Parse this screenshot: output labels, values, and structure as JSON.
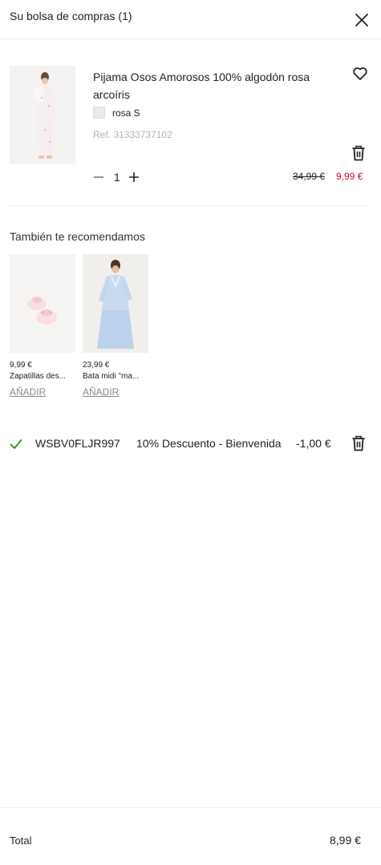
{
  "header": {
    "title": "Su bolsa de compras (1)",
    "close_icon": "close-icon"
  },
  "cart_item": {
    "name": "Pijama Osos Amorosos 100% algodón rosa arcoíris",
    "variant": "rosa S",
    "swatch_color": "#f0e8e4",
    "ref": "Ref. 31333737102",
    "quantity": "1",
    "price_old": "34,99 €",
    "price_new": "9,99 €",
    "sale_color": "#c8102e"
  },
  "recommendations": {
    "title": "También te recomendamos",
    "items": [
      {
        "price": "9,99 €",
        "name": "Zapatillas des...",
        "add_label": "AÑADIR"
      },
      {
        "price": "23,99 €",
        "name": "Bata midi \"ma...",
        "add_label": "AÑADIR"
      }
    ]
  },
  "promo": {
    "code": "WSBV0FLJR997",
    "description": "10% Descuento - Bienvenida",
    "amount": "-1,00 €",
    "check_color": "#3a8a1f"
  },
  "footer": {
    "label": "Total",
    "total": "8,99 €"
  }
}
